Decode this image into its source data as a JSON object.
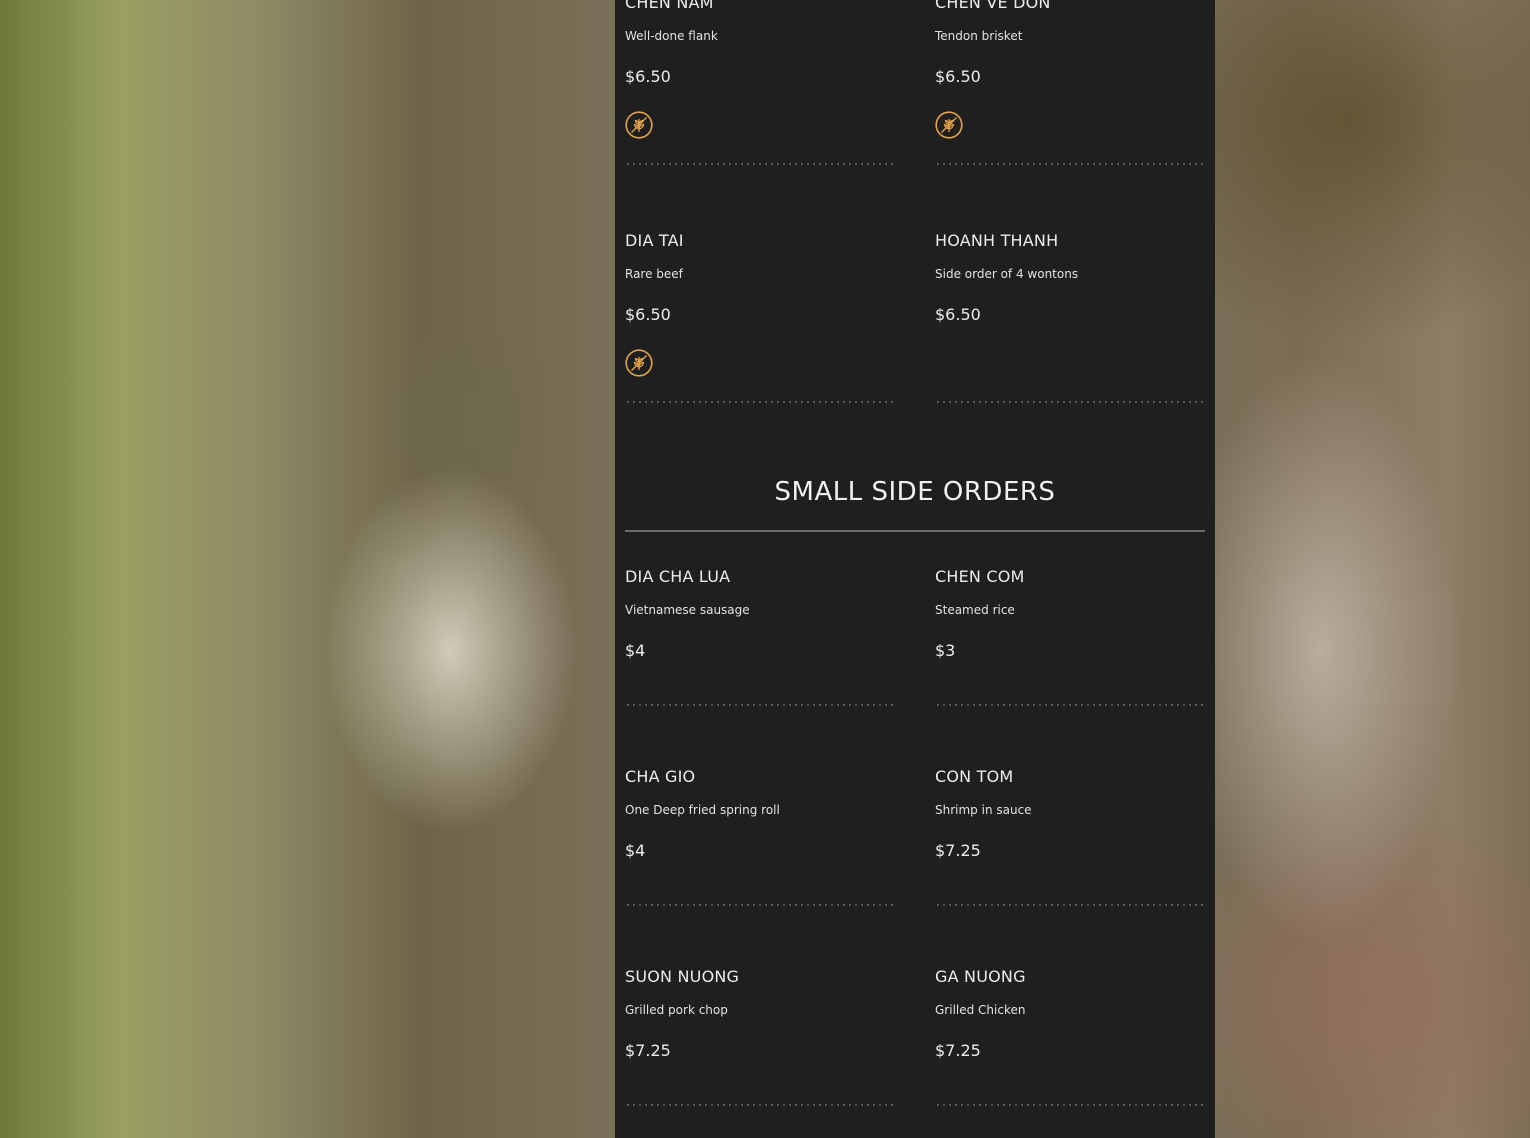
{
  "colors": {
    "panel_bg": "#1f1f1f",
    "text": "#ececec",
    "gluten_free_icon": "#e3a349",
    "divider": "#6d6d6d"
  },
  "top_items": [
    {
      "name": "CHEN NAM",
      "desc": "Well-done flank",
      "price": "$6.50",
      "icon": "gluten-free-wheat-icon"
    },
    {
      "name": "CHEN VE DON",
      "desc": "Tendon brisket",
      "price": "$6.50",
      "icon": "gluten-free-wheat-icon"
    },
    {
      "name": "DIA TAI",
      "desc": "Rare beef",
      "price": "$6.50",
      "icon": "gluten-free-wheat-icon"
    },
    {
      "name": "HOANH THANH",
      "desc": "Side order of 4 wontons",
      "price": "$6.50"
    }
  ],
  "section": {
    "title": "SMALL SIDE ORDERS",
    "items": [
      {
        "name": "DIA CHA LUA",
        "desc": "Vietnamese sausage",
        "price": "$4"
      },
      {
        "name": "CHEN COM",
        "desc": "Steamed rice",
        "price": "$3"
      },
      {
        "name": "CHA GIO",
        "desc": "One Deep fried spring roll",
        "price": "$4"
      },
      {
        "name": "CON TOM",
        "desc": "Shrimp in sauce",
        "price": "$7.25"
      },
      {
        "name": "SUON NUONG",
        "desc": "Grilled pork chop",
        "price": "$7.25"
      },
      {
        "name": "GA NUONG",
        "desc": "Grilled Chicken",
        "price": "$7.25"
      }
    ]
  }
}
